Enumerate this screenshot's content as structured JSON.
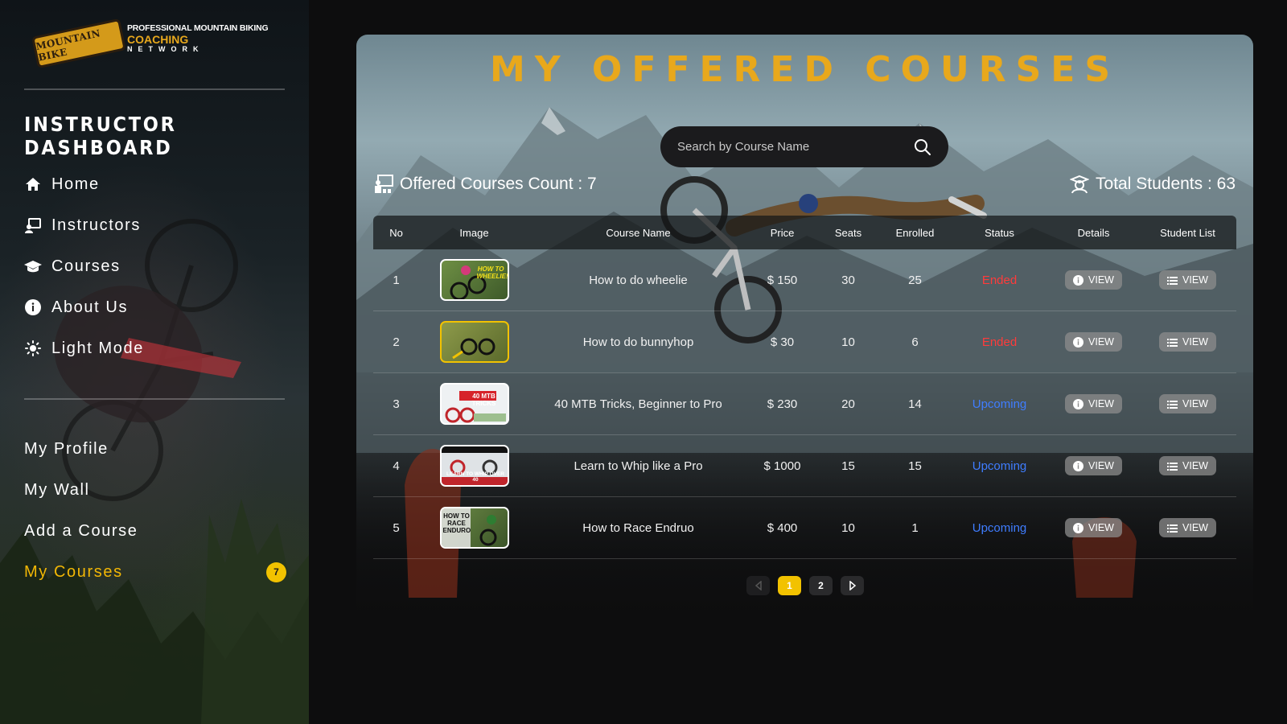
{
  "brand": {
    "badge_text": "MOUNTAIN BIKE",
    "line1": "PROFESSIONAL MOUNTAIN BIKING",
    "line2": "COACHING",
    "line3": "NETWORK"
  },
  "sidebar": {
    "title": "INSTRUCTOR DASHBOARD",
    "nav": [
      {
        "label": "Home",
        "icon": "home-icon"
      },
      {
        "label": "Instructors",
        "icon": "instructor-board-icon"
      },
      {
        "label": "Courses",
        "icon": "graduation-cap-icon"
      },
      {
        "label": "About Us",
        "icon": "info-icon"
      },
      {
        "label": "Light Mode",
        "icon": "sun-icon"
      }
    ],
    "nav2": [
      {
        "label": "My Profile"
      },
      {
        "label": "My Wall"
      },
      {
        "label": "Add a Course"
      },
      {
        "label": "My Courses",
        "badge": "7",
        "active": true
      }
    ]
  },
  "main": {
    "title": "MY OFFERED COURSES",
    "search_placeholder": "Search by Course Name",
    "count_label": "Offered Courses Count : 7",
    "students_label": "Total Students : 63",
    "columns": [
      "No",
      "Image",
      "Course Name",
      "Price",
      "Seats",
      "Enrolled",
      "Status",
      "Details",
      "Student List"
    ],
    "rows": [
      {
        "no": "1",
        "name": "How to do wheelie",
        "price": "$ 150",
        "seats": "30",
        "enrolled": "25",
        "status": "Ended"
      },
      {
        "no": "2",
        "name": "How to do bunnyhop",
        "price": "$ 30",
        "seats": "10",
        "enrolled": "6",
        "status": "Ended"
      },
      {
        "no": "3",
        "name": "40 MTB Tricks, Beginner to Pro",
        "price": "$ 230",
        "seats": "20",
        "enrolled": "14",
        "status": "Upcoming"
      },
      {
        "no": "4",
        "name": "Learn to Whip like a Pro",
        "price": "$ 1000",
        "seats": "15",
        "enrolled": "15",
        "status": "Upcoming"
      },
      {
        "no": "5",
        "name": "How to Race Endruo",
        "price": "$ 400",
        "seats": "10",
        "enrolled": "1",
        "status": "Upcoming"
      }
    ],
    "thumbs": [
      {
        "text": "HOW TO WHEELIE!",
        "bg": "#5a7a3a"
      },
      {
        "text": "",
        "bg": "#6e7d3a"
      },
      {
        "text": "40 MTB TRICKS",
        "bg": "#e9eef2"
      },
      {
        "text": "LEARN TO WHIP OVER 40",
        "bg": "#d9dde0"
      },
      {
        "text": "HOW TO RACE ENDURO",
        "bg": "#4f6a35"
      }
    ],
    "view_label": "VIEW",
    "pagination": {
      "pages": [
        "1",
        "2"
      ],
      "current": "1"
    }
  },
  "colors": {
    "accent": "#e8a81c",
    "badge": "#f2c200",
    "ended": "#ff3b3b",
    "upcoming": "#3f7dff"
  }
}
